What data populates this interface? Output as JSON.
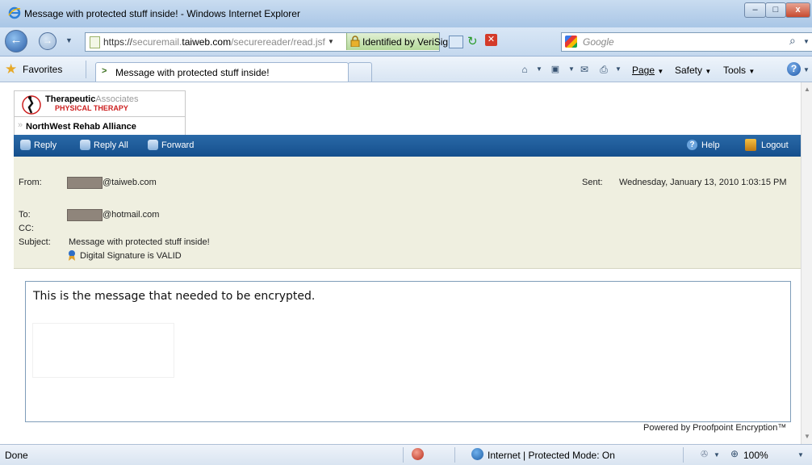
{
  "window": {
    "title": "Message with protected stuff inside! - Windows Internet Explorer",
    "minimize": "–",
    "maximize": "□",
    "close": "x"
  },
  "addressbar": {
    "url_prefix": "https://",
    "url_pre": "securemail.",
    "url_domain": "taiweb.com",
    "url_path": "/securereader/read.jsf",
    "identified": "Identified by VeriSign",
    "search_placeholder": "Google"
  },
  "favbar": {
    "favorites": "Favorites",
    "tab_title": "Message with protected stuff inside!",
    "page": "Page",
    "safety": "Safety",
    "tools": "Tools"
  },
  "logo": {
    "brand_bold": "Therapeutic",
    "brand_light": "Associates",
    "brand_sub": "PHYSICAL THERAPY",
    "alliance": "NorthWest Rehab Alliance"
  },
  "toolbar": {
    "reply": "Reply",
    "reply_all": "Reply All",
    "forward": "Forward",
    "help": "Help",
    "logout": "Logout"
  },
  "message": {
    "from_label": "From:",
    "from_value": "@taiweb.com",
    "sent_label": "Sent:",
    "sent_value": "Wednesday, January 13, 2010 1:03:15 PM",
    "to_label": "To:",
    "to_value": "@hotmail.com",
    "cc_label": "CC:",
    "subject_label": "Subject:",
    "subject_value": "Message with protected stuff inside!",
    "signature": "Digital Signature is VALID",
    "body": "This is the message that needed to be encrypted.",
    "powered": "Powered by Proofpoint Encryption™"
  },
  "status": {
    "left": "Done",
    "zone": "Internet | Protected Mode: On",
    "zoom": "100%"
  },
  "colors": {
    "nav_strip": "#1c5a98",
    "header_panel": "#efefe0",
    "secure_green": "#b4d99a",
    "logo_red": "#cc1f1f"
  }
}
